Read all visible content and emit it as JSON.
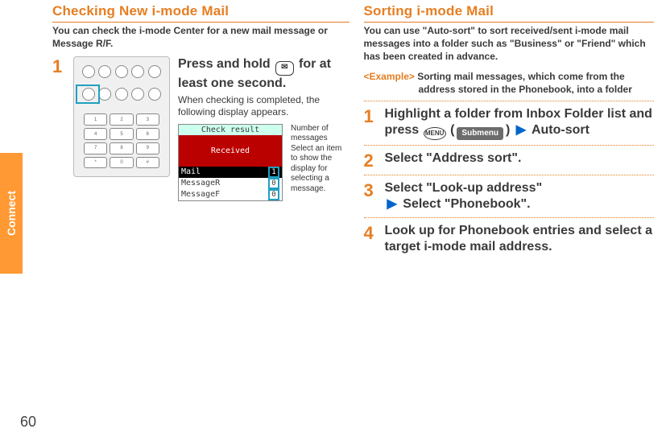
{
  "side_tab": "Connect",
  "page_number": "60",
  "left": {
    "heading": "Checking New i-mode Mail",
    "intro": "You can check the i-mode Center for a new mail message or Message R/F.",
    "step1": {
      "num": "1",
      "title_a": "Press and hold ",
      "title_b": " for at least one second.",
      "mail_icon": "✉",
      "note": "When checking is completed, the following display appears.",
      "screen": {
        "title": "Check result",
        "band": "Received",
        "rows": {
          "r1": {
            "label": "Mail",
            "count": "1"
          },
          "r2": {
            "label": "MessageR",
            "count": "0"
          },
          "r3": {
            "label": "MessageF",
            "count": "0"
          }
        }
      },
      "annotation": {
        "l1": "Number of messages",
        "l2": "Select an item to show the display for selecting a message."
      }
    }
  },
  "right": {
    "heading": "Sorting i-mode Mail",
    "intro": "You can use \"Auto-sort\" to sort received/sent i-mode mail messages into a folder such as \"Business\" or \"Friend\" which has been created in advance.",
    "example_label": "<Example>",
    "example_text_a": "Sorting mail messages, which come from the",
    "example_text_b": "address stored in the Phonebook, into a folder",
    "steps": {
      "s1": {
        "num": "1",
        "line_a": "Highlight a folder from Inbox Folder list and press ",
        "menu": "MENU",
        "paren_open": "(",
        "submenu": "Submenu",
        "paren_close": ")",
        "arrow": "▶",
        "tail": "Auto-sort"
      },
      "s2": {
        "num": "2",
        "text": "Select \"Address sort\"."
      },
      "s3": {
        "num": "3",
        "line_a": "Select \"Look-up address\"",
        "arrow": "▶",
        "line_b": "Select \"Phonebook\"."
      },
      "s4": {
        "num": "4",
        "text": "Look up for Phonebook entries and select a target i-mode mail address."
      }
    }
  }
}
